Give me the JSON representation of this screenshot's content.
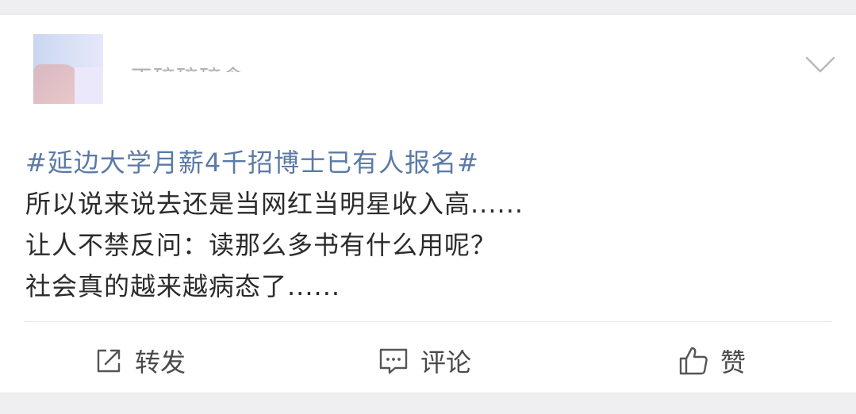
{
  "post": {
    "author_name": "正碎碎碎念",
    "hashtag": "#延边大学月薪4千招博士已有人报名#",
    "lines": [
      "所以说来说去还是当网红当明星收入高......",
      "让人不禁反问：读那么多书有什么用呢？",
      "社会真的越来越病态了......"
    ]
  },
  "actions": {
    "repost_label": "转发",
    "comment_label": "评论",
    "like_label": "赞"
  },
  "icons": {
    "menu": "chevron-down-icon",
    "repost": "share-icon",
    "comment": "comment-icon",
    "like": "thumbs-up-icon"
  },
  "colors": {
    "hashtag": "#5b7aa6",
    "text": "#2b2b2b",
    "background": "#efeff1"
  }
}
